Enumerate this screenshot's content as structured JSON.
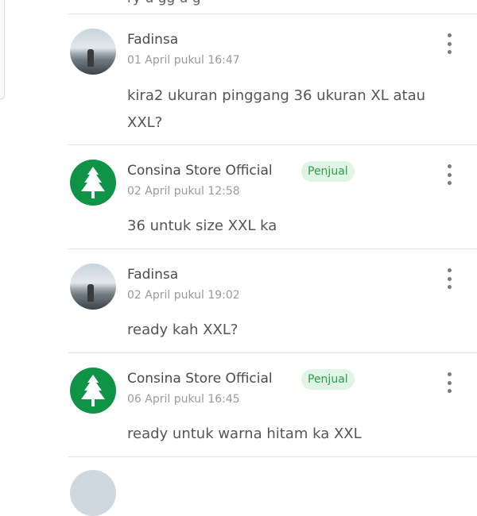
{
  "top_partial": {
    "text": "ry u gg u     g"
  },
  "comments": [
    {
      "name": "Fadinsa",
      "date": "01 April pukul 16:47",
      "text": "kira2 ukuran pinggang 36 ukuran XL atau XXL?",
      "avatar": "user-photo-avatar"
    },
    {
      "name": "Consina Store Official",
      "badge": "Penjual",
      "date": "02 April pukul 12:58",
      "text": "36 untuk size XXL ka",
      "avatar": "tree-logo-avatar"
    },
    {
      "name": "Fadinsa",
      "date": "02 April pukul 19:02",
      "text": "ready kah XXL?",
      "avatar": "user-photo-avatar"
    },
    {
      "name": "Consina Store Official",
      "badge": "Penjual",
      "date": "06 April pukul 16:45",
      "text": "ready untuk warna hitam ka XXL",
      "avatar": "tree-logo-avatar"
    }
  ],
  "colors": {
    "brand_green": "#0f9447",
    "badge_bg": "#dff5e5",
    "badge_text": "#2f9c4a",
    "divider": "#e2e2e2"
  },
  "icons": {
    "more": "more-vertical-icon",
    "tree": "pine-tree-icon"
  }
}
